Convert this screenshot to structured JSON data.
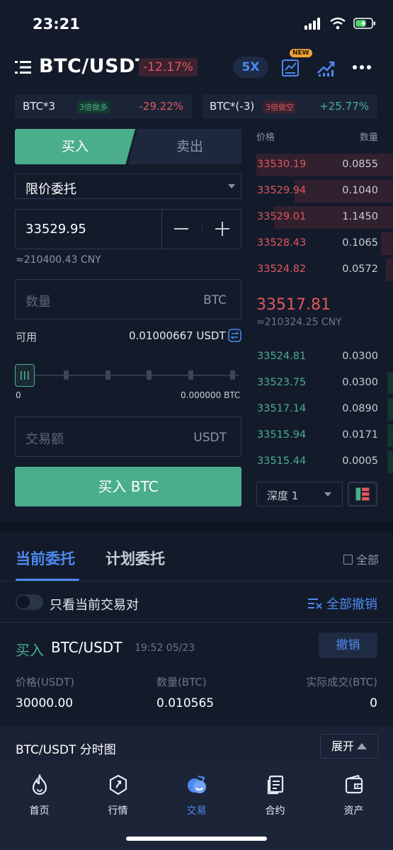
{
  "status_bar": {
    "time": "23:21"
  },
  "header": {
    "pair": "BTC/USDT",
    "change": "-12.17%",
    "leverage": "5X",
    "new_badge": "NEW"
  },
  "leveraged_tokens": [
    {
      "name": "BTC*3",
      "tag": "3倍做多",
      "change": "-29.22%"
    },
    {
      "name": "BTC*(-3)",
      "tag": "3倍做空",
      "change": "+25.77%"
    }
  ],
  "trade_form": {
    "buy_tab": "买入",
    "sell_tab": "卖出",
    "order_type": "限价委托",
    "price": "33529.95",
    "price_cny": "≈210400.43 CNY",
    "quantity_placeholder": "数量",
    "quantity_unit": "BTC",
    "available_label": "可用",
    "available_value": "0.01000667 USDT",
    "slider_min": "0",
    "slider_max": "0.000000 BTC",
    "slider_percent": 0,
    "amount_placeholder": "交易额",
    "amount_unit": "USDT",
    "submit_label": "买入 BTC"
  },
  "order_book": {
    "price_header": "价格",
    "qty_header": "数量",
    "asks": [
      {
        "price": "33530.19",
        "qty": "0.0855",
        "depth": 1.0
      },
      {
        "price": "33529.94",
        "qty": "0.1040",
        "depth": 0.72
      },
      {
        "price": "33529.01",
        "qty": "1.1450",
        "depth": 0.87
      },
      {
        "price": "33528.43",
        "qty": "0.1065",
        "depth": 0.09
      },
      {
        "price": "33524.82",
        "qty": "0.0572",
        "depth": 0.05
      }
    ],
    "last_price": "33517.81",
    "last_price_cny": "≈210324.25 CNY",
    "bids": [
      {
        "price": "33524.81",
        "qty": "0.0300",
        "depth": 0.0
      },
      {
        "price": "33523.75",
        "qty": "0.0300",
        "depth": 0.04
      },
      {
        "price": "33517.14",
        "qty": "0.0890",
        "depth": 0.04
      },
      {
        "price": "33515.94",
        "qty": "0.0171",
        "depth": 0.04
      },
      {
        "price": "33515.44",
        "qty": "0.0005",
        "depth": 0.04
      }
    ],
    "depth_selector": "深度 1"
  },
  "orders": {
    "tab_current": "当前委托",
    "tab_plan": "计划委托",
    "all_label": "全部",
    "filter_label": "只看当前交易对",
    "cancel_all_label": "全部撤销",
    "item": {
      "side": "买入",
      "pair": "BTC/USDT",
      "time": "19:52 05/23",
      "cancel_label": "撤销",
      "price_header": "价格(USDT)",
      "qty_header": "数量(BTC)",
      "filled_header": "实际成交(BTC)",
      "price": "30000.00",
      "qty": "0.010565",
      "filled": "0"
    }
  },
  "chart_bar": {
    "title": "BTC/USDT 分时图",
    "expand_label": "展开"
  },
  "tabbar": {
    "items": [
      {
        "label": "首页",
        "icon": "flame-icon"
      },
      {
        "label": "行情",
        "icon": "market-icon"
      },
      {
        "label": "交易",
        "icon": "trade-icon"
      },
      {
        "label": "合约",
        "icon": "contract-icon"
      },
      {
        "label": "资产",
        "icon": "wallet-icon"
      }
    ],
    "active_index": 2
  },
  "colors": {
    "buy_green": "#4aae8c",
    "sell_red": "#e0575f",
    "accent_blue": "#4d8af0",
    "background": "#131b2b"
  }
}
